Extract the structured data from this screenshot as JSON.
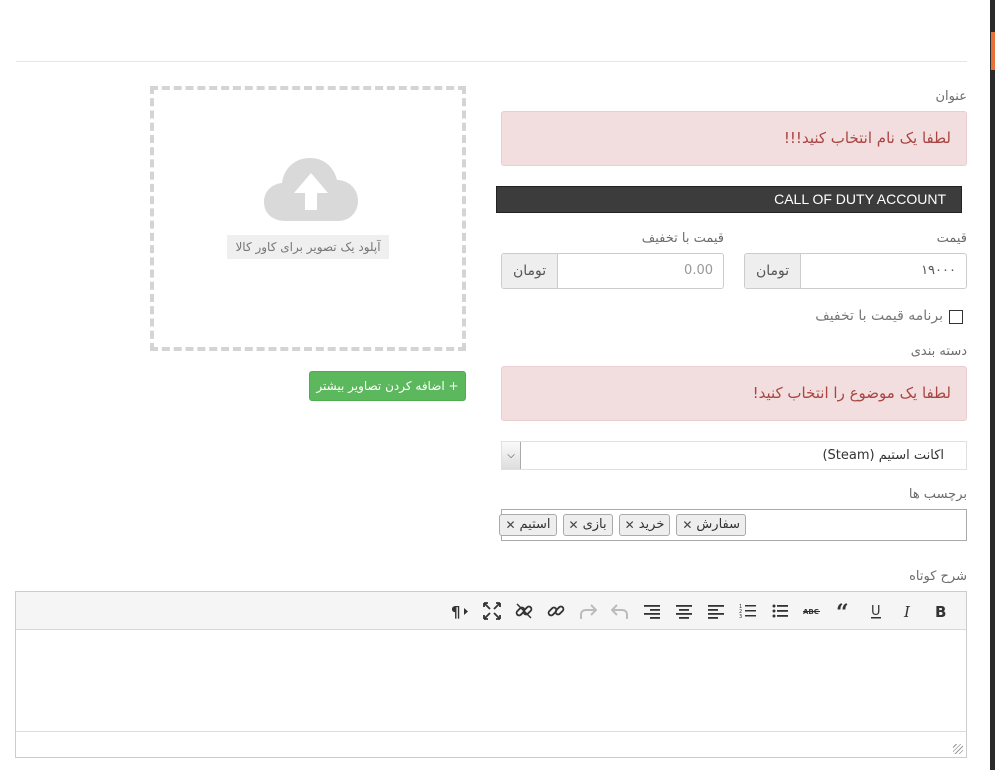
{
  "form": {
    "title_label": "عنوان",
    "title_alert": "لطفا یک نام انتخاب کنید!!!",
    "product_name": "CALL OF DUTY ACCOUNT",
    "price_label": "قیمت",
    "price_value": "۱۹۰۰۰",
    "price_currency": "تومان",
    "discount_label": "قیمت با تخفیف",
    "discount_placeholder": "0.00",
    "discount_currency": "تومان",
    "discount_schedule_label": "برنامه قیمت با تخفیف",
    "category_label": "دسته بندی",
    "category_alert": "لطفا یک موضوع را انتخاب کنید!",
    "category_selected": "اکانت استیم (Steam)",
    "tags_label": "برچسب ها",
    "tags": [
      "سفارش",
      "خرید",
      "بازی",
      "استیم"
    ],
    "short_desc_label": "شرح کوتاه"
  },
  "upload": {
    "label": "آپلود یک تصویر برای کاور کالا",
    "add_more_label": "+ اضافه کردن تصاویر بیشتر"
  },
  "editor": {
    "toolbar": [
      "bold-icon",
      "italic-icon",
      "underline-icon",
      "blockquote-icon",
      "strikethrough-icon",
      "bullet-list-icon",
      "numbered-list-icon",
      "align-left-icon",
      "align-center-icon",
      "align-right-icon",
      "undo-icon",
      "redo-icon",
      "link-icon",
      "unlink-icon",
      "fullscreen-icon",
      "paragraph-icon"
    ]
  },
  "colors": {
    "alert_bg": "#f2dede",
    "alert_text": "#a94442",
    "add_button": "#5cb85c",
    "dark_bar": "#3c3c3c",
    "accent": "#e8703a"
  }
}
